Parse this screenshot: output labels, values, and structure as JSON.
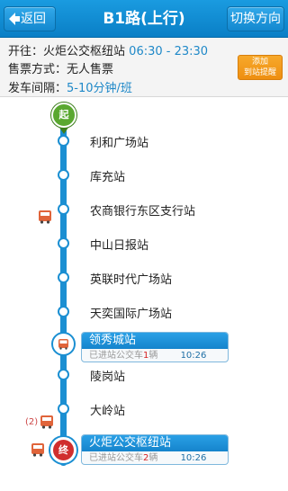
{
  "header": {
    "back_label": "返回",
    "title": "B1路(上行)",
    "switch_label": "切换方向"
  },
  "info": {
    "terminal_prefix": "开往：",
    "terminal_name": "火炬公交枢纽站",
    "service_hours": "06:30 - 23:30",
    "ticket_label": "售票方式：",
    "ticket_value": "无人售票",
    "interval_label": "发车间隔：",
    "interval_value": "5-10分钟/班",
    "remind_line1": "添加",
    "remind_line2": "到站提醒"
  },
  "markers": {
    "start": "起",
    "end": "终"
  },
  "stops": [
    {
      "name": "利和广场站"
    },
    {
      "name": "库充站"
    },
    {
      "name": "农商银行东区支行站"
    },
    {
      "name": "中山日报站"
    },
    {
      "name": "英联时代广场站"
    },
    {
      "name": "天奕国际广场站"
    },
    {
      "name": "领秀城站"
    },
    {
      "name": "陵岗站"
    },
    {
      "name": "大岭站"
    },
    {
      "name": "火炬公交枢纽站"
    }
  ],
  "callouts": [
    {
      "station": "领秀城站",
      "prefix": "已进站公交车",
      "count": "1",
      "unit": "辆",
      "time": "10:26"
    },
    {
      "station": "火炬公交枢纽站",
      "prefix": "已进站公交车",
      "count": "2",
      "unit": "辆",
      "time": "10:26"
    }
  ],
  "side_bus_count": "(2)",
  "colors": {
    "header_blue": "#1a9be0",
    "line_blue": "#1b8fd2",
    "start_green": "#5aa830",
    "end_red": "#d02e2e",
    "remind_orange": "#f29b1c"
  }
}
